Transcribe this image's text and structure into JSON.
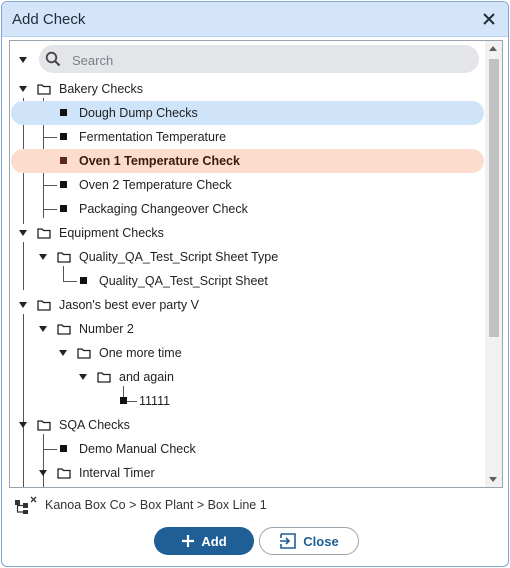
{
  "dialog": {
    "title": "Add Check"
  },
  "search": {
    "placeholder": "Search",
    "value": ""
  },
  "tree": {
    "bakery": {
      "label": "Bakery Checks",
      "items": [
        "Dough Dump Checks",
        "Fermentation Temperature",
        "Oven 1 Temperature Check",
        "Oven 2 Temperature Check",
        "Packaging Changeover Check"
      ]
    },
    "equipment": {
      "label": "Equipment Checks",
      "sub": {
        "label": "Quality_QA_Test_Script Sheet Type",
        "items": [
          "Quality_QA_Test_Script Sheet"
        ]
      }
    },
    "jason": {
      "label": "Jason's best ever party V",
      "number2": "Number 2",
      "onemore": "One more time",
      "again": "and again",
      "leaf": "11111"
    },
    "sqa": {
      "label": "SQA Checks",
      "items": [
        "Demo Manual Check"
      ],
      "interval": "Interval Timer"
    }
  },
  "location": {
    "path": "Kanoa Box Co > Box Plant > Box Line 1"
  },
  "buttons": {
    "add": "Add",
    "close": "Close"
  },
  "colors": {
    "selected": "#cfe3f9",
    "active": "#fcdccc",
    "primary": "#1f5f96",
    "titlebar": "#d4e5f9"
  }
}
